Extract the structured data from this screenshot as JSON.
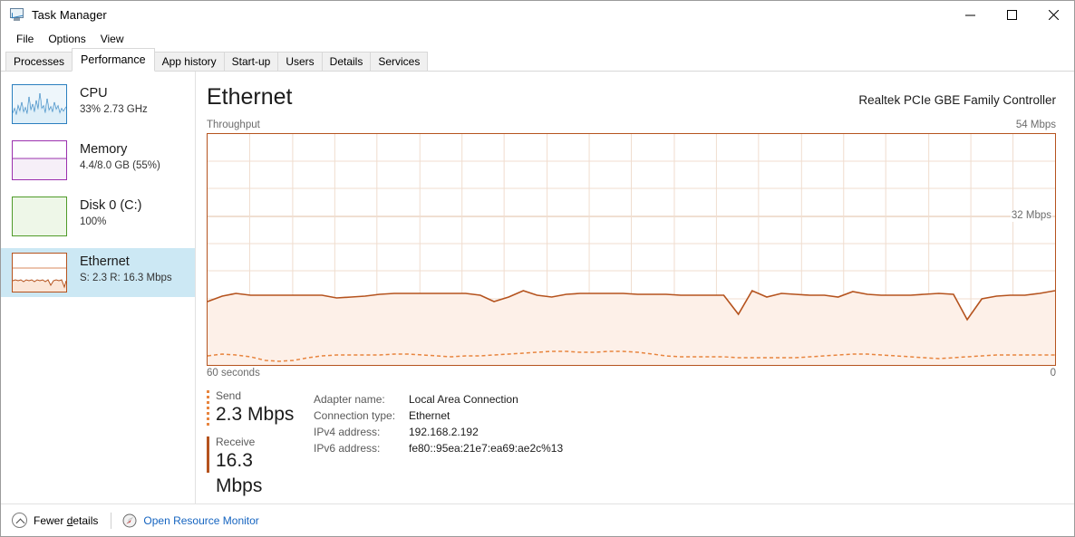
{
  "window": {
    "title": "Task Manager",
    "icon": "task-manager-icon",
    "controls": {
      "minimize": "minimize-icon",
      "maximize": "maximize-icon",
      "close": "close-icon"
    }
  },
  "menu": {
    "items": [
      {
        "label": "File"
      },
      {
        "label": "Options"
      },
      {
        "label": "View"
      }
    ]
  },
  "tabs": {
    "active": "Performance",
    "items": [
      {
        "label": "Processes",
        "active": false
      },
      {
        "label": "Performance",
        "active": true
      },
      {
        "label": "App history",
        "active": false
      },
      {
        "label": "Start-up",
        "active": false
      },
      {
        "label": "Users",
        "active": false
      },
      {
        "label": "Details",
        "active": false
      },
      {
        "label": "Services",
        "active": false
      }
    ]
  },
  "sidebar": {
    "items": [
      {
        "title": "CPU",
        "subtitle": "33% 2.73 GHz",
        "accent": "#2b7fbf",
        "selected": false,
        "thumb": "cpu-thumbnail"
      },
      {
        "title": "Memory",
        "subtitle": "4.4/8.0 GB (55%)",
        "accent": "#9b30ae",
        "selected": false,
        "thumb": "memory-thumbnail"
      },
      {
        "title": "Disk 0 (C:)",
        "subtitle": "100%",
        "accent": "#4f9b29",
        "selected": false,
        "thumb": "disk-thumbnail"
      },
      {
        "title": "Ethernet",
        "subtitle": "S: 2.3 R: 16.3 Mbps",
        "accent": "#b5531e",
        "selected": true,
        "thumb": "ethernet-thumbnail"
      }
    ]
  },
  "main": {
    "title": "Ethernet",
    "adapter": "Realtek PCIe GBE Family Controller",
    "graph_label": "Throughput",
    "graph_max": "54 Mbps",
    "graph_mid": "32 Mbps",
    "graph_time": "60 seconds",
    "graph_zero": "0",
    "stats": {
      "send": {
        "label": "Send",
        "value": "2.3 Mbps",
        "color": "#e8853f"
      },
      "receive": {
        "label": "Receive",
        "value": "16.3 Mbps",
        "color": "#b5531e"
      }
    },
    "info": [
      {
        "key": "Adapter name:",
        "value": "Local Area Connection"
      },
      {
        "key": "Connection type:",
        "value": "Ethernet"
      },
      {
        "key": "IPv4 address:",
        "value": "192.168.2.192"
      },
      {
        "key": "IPv6 address:",
        "value": "fe80::95ea:21e7:ea69:ae2c%13"
      }
    ]
  },
  "footer": {
    "fewer_details_pre": "Fewer ",
    "fewer_details_underline": "d",
    "fewer_details_post": "etails",
    "resource_monitor": "Open Resource Monitor"
  },
  "chart_data": {
    "type": "area",
    "title": "Throughput",
    "xlabel": "60 seconds",
    "ylabel": "Mbps",
    "ylim": [
      0,
      54
    ],
    "y_ticks": [
      0,
      32,
      54
    ],
    "grid": true,
    "legend_position": "below",
    "series": [
      {
        "name": "Receive",
        "style": "solid-filled",
        "color": "#b5531e",
        "fill": "#fdf0e8",
        "current": 16.3,
        "values": [
          14.8,
          16.2,
          17.0,
          16.3,
          16.3,
          16.3,
          16.3,
          16.3,
          16.3,
          15.6,
          15.9,
          16.2,
          16.5,
          16.6,
          16.6,
          16.6,
          16.6,
          16.6,
          16.6,
          16.3,
          14.9,
          16.0,
          17.4,
          16.2,
          15.9,
          16.4,
          16.6,
          16.6,
          16.6,
          16.6,
          16.5,
          16.5,
          16.4,
          16.3,
          16.3,
          16.3,
          16.2,
          11.8,
          17.3,
          15.9,
          16.6,
          16.4,
          16.2,
          16.2,
          15.8,
          17.1,
          16.4,
          16.2,
          16.3,
          16.3,
          16.5,
          16.6,
          16.5,
          10.6,
          15.2,
          16.0,
          16.2,
          16.3,
          16.6,
          17.4
        ]
      },
      {
        "name": "Send",
        "style": "dashed",
        "color": "#e8853f",
        "current": 2.3,
        "values": [
          2.1,
          2.4,
          2.3,
          2.0,
          1.6,
          1.5,
          1.6,
          1.9,
          2.2,
          2.3,
          2.3,
          2.3,
          2.3,
          2.4,
          2.4,
          2.3,
          2.1,
          2.0,
          2.1,
          2.2,
          2.3,
          2.4,
          2.5,
          2.6,
          2.7,
          2.7,
          2.6,
          2.6,
          2.7,
          2.7,
          2.6,
          2.4,
          2.2,
          2.1,
          2.1,
          2.1,
          2.1,
          2.0,
          2.0,
          2.0,
          2.0,
          2.0,
          2.1,
          2.2,
          2.3,
          2.4,
          2.4,
          2.3,
          2.2,
          2.1,
          2.0,
          1.9,
          2.0,
          2.1,
          2.2,
          2.3,
          2.3,
          2.3,
          2.3,
          2.3
        ]
      }
    ]
  }
}
